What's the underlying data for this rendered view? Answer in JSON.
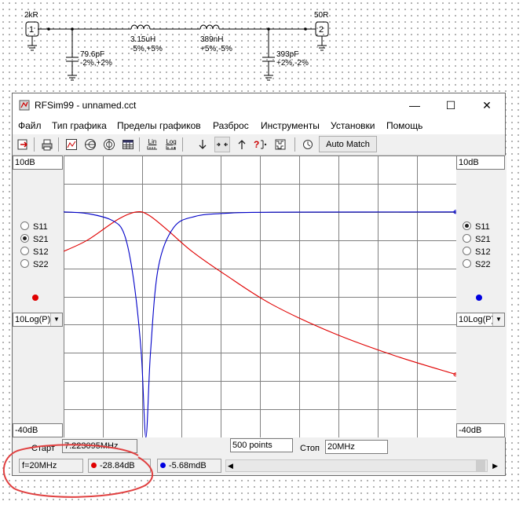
{
  "schematic": {
    "port1": {
      "number": "1",
      "impedance": "2kR"
    },
    "port2": {
      "number": "2",
      "impedance": "50R"
    },
    "c1": {
      "value": "79.6pF",
      "tolerance": "-2%,+2%"
    },
    "l1": {
      "value": "3.15uH",
      "tolerance": "-5%,+5%"
    },
    "l2": {
      "value": "389nH",
      "tolerance": "+5%,-5%"
    },
    "c2": {
      "value": "393pF",
      "tolerance": "+2%,-2%"
    }
  },
  "window": {
    "title": "RFSim99 - unnamed.cct",
    "controls": {
      "minimize": "—",
      "maximize": "☐",
      "close": "✕"
    }
  },
  "menu": [
    "Файл",
    "Тип графика",
    "Пределы графиков",
    "Разброс",
    "Инструменты",
    "Установки",
    "Помощь"
  ],
  "toolbar": {
    "lin_label": "Lin",
    "log_label": "Log",
    "automatch_label": "Auto Match"
  },
  "left_panel": {
    "top_value": "10dB",
    "bottom_value": "-40dB",
    "radios": [
      "S11",
      "S21",
      "S12",
      "S22"
    ],
    "selected": "S21",
    "marker_color": "#e00000",
    "scale_mode": "10Log(P)"
  },
  "right_panel": {
    "top_value": "10dB",
    "bottom_value": "-40dB",
    "radios": [
      "S11",
      "S21",
      "S12",
      "S22"
    ],
    "selected": "S11",
    "marker_color": "#0000e0",
    "scale_mode": "10Log(P)"
  },
  "plot": {
    "grid_background": "#ffffff",
    "grid_color": "#808080",
    "red_trace_color": "#e00000",
    "blue_trace_color": "#0000c8"
  },
  "sweep": {
    "start_label": "Старт",
    "start_value": "7.223095MHz",
    "points": "500 points",
    "stop_label": "Стоп",
    "stop_value": "20MHz"
  },
  "status": {
    "frequency": "f=20MHz",
    "red_readout": "-28.84dB",
    "blue_readout": "-5.68mdB"
  },
  "chart_data": {
    "type": "line",
    "xlim": [
      7.223095,
      20
    ],
    "ylim": [
      -40,
      10
    ],
    "ylabel": "",
    "xlabel": "",
    "grid": true,
    "series": [
      {
        "color": "#e00000",
        "x": [
          7.223,
          8.0,
          9.0,
          9.6,
          10.0,
          10.6,
          11.4,
          12.5,
          14.0,
          16.0,
          18.0,
          20.0
        ],
        "values": [
          -7.0,
          -5.0,
          -1.3,
          0.0,
          -0.6,
          -3.2,
          -7.0,
          -11.2,
          -16.4,
          -21.5,
          -25.5,
          -28.84
        ]
      },
      {
        "color": "#0000c8",
        "x": [
          7.223,
          8.0,
          8.8,
          9.2,
          9.5,
          9.75,
          9.9,
          10.05,
          10.3,
          10.8,
          11.5,
          12.5,
          14.0,
          20.0
        ],
        "values": [
          0.0,
          -0.3,
          -1.5,
          -4.0,
          -12.0,
          -25.0,
          -40.0,
          -25.0,
          -10.0,
          -2.8,
          -0.8,
          -0.25,
          -0.05,
          -0.006
        ]
      }
    ]
  }
}
